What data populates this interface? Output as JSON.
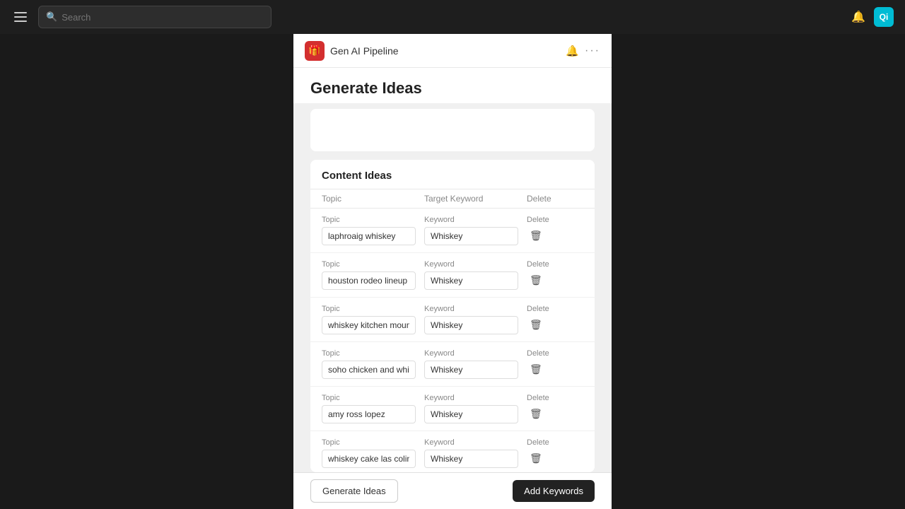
{
  "nav": {
    "search_placeholder": "Search",
    "avatar_initials": "Qi"
  },
  "page_header": {
    "app_icon": "🎁",
    "app_title": "Gen AI Pipeline",
    "bell_icon": "🔔",
    "more_icon": "•••"
  },
  "page_title": "Generate Ideas",
  "content_ideas": {
    "section_title": "Content Ideas",
    "table_headers": {
      "topic": "Topic",
      "keyword": "Target Keyword",
      "delete": "Delete"
    },
    "rows": [
      {
        "topic_label": "Topic",
        "topic_value": "laphroaig whiskey",
        "keyword_label": "Keyword",
        "keyword_value": "Whiskey",
        "delete_label": "Delete"
      },
      {
        "topic_label": "Topic",
        "topic_value": "houston rodeo lineup",
        "keyword_label": "Keyword",
        "keyword_value": "Whiskey",
        "delete_label": "Delete"
      },
      {
        "topic_label": "Topic",
        "topic_value": "whiskey kitchen mount dora",
        "keyword_label": "Keyword",
        "keyword_value": "Whiskey",
        "delete_label": "Delete"
      },
      {
        "topic_label": "Topic",
        "topic_value": "soho chicken and whiskey",
        "keyword_label": "Keyword",
        "keyword_value": "Whiskey",
        "delete_label": "Delete"
      },
      {
        "topic_label": "Topic",
        "topic_value": "amy ross lopez",
        "keyword_label": "Keyword",
        "keyword_value": "Whiskey",
        "delete_label": "Delete"
      },
      {
        "topic_label": "Topic",
        "topic_value": "whiskey cake las colinas",
        "keyword_label": "Keyword",
        "keyword_value": "Whiskey",
        "delete_label": "Delete"
      }
    ]
  },
  "bottom_bar": {
    "generate_label": "Generate Ideas",
    "add_keywords_label": "Add Keywords"
  }
}
